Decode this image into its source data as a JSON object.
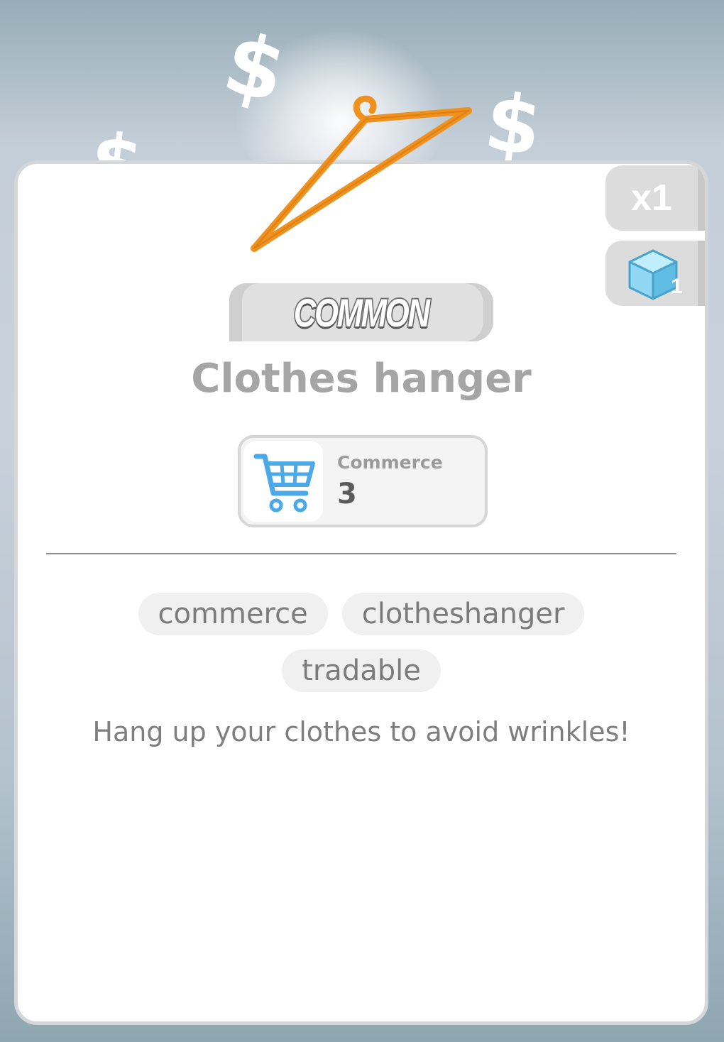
{
  "item": {
    "name": "Clothes hanger",
    "rarity": "COMMON",
    "quantity": "x1",
    "cube_count": "1",
    "stat": {
      "label": "Commerce",
      "value": "3"
    },
    "tags": [
      "commerce",
      "clotheshanger",
      "tradable"
    ],
    "description": "Hang up your clothes to avoid wrinkles!"
  },
  "colors": {
    "hanger": "#f0911e",
    "cart_icon": "#4aa9e6",
    "cube_icon": "#7fd3f0"
  },
  "icons": [
    "dollar-icon",
    "hanger-icon",
    "cube-icon",
    "shopping-cart-icon"
  ]
}
